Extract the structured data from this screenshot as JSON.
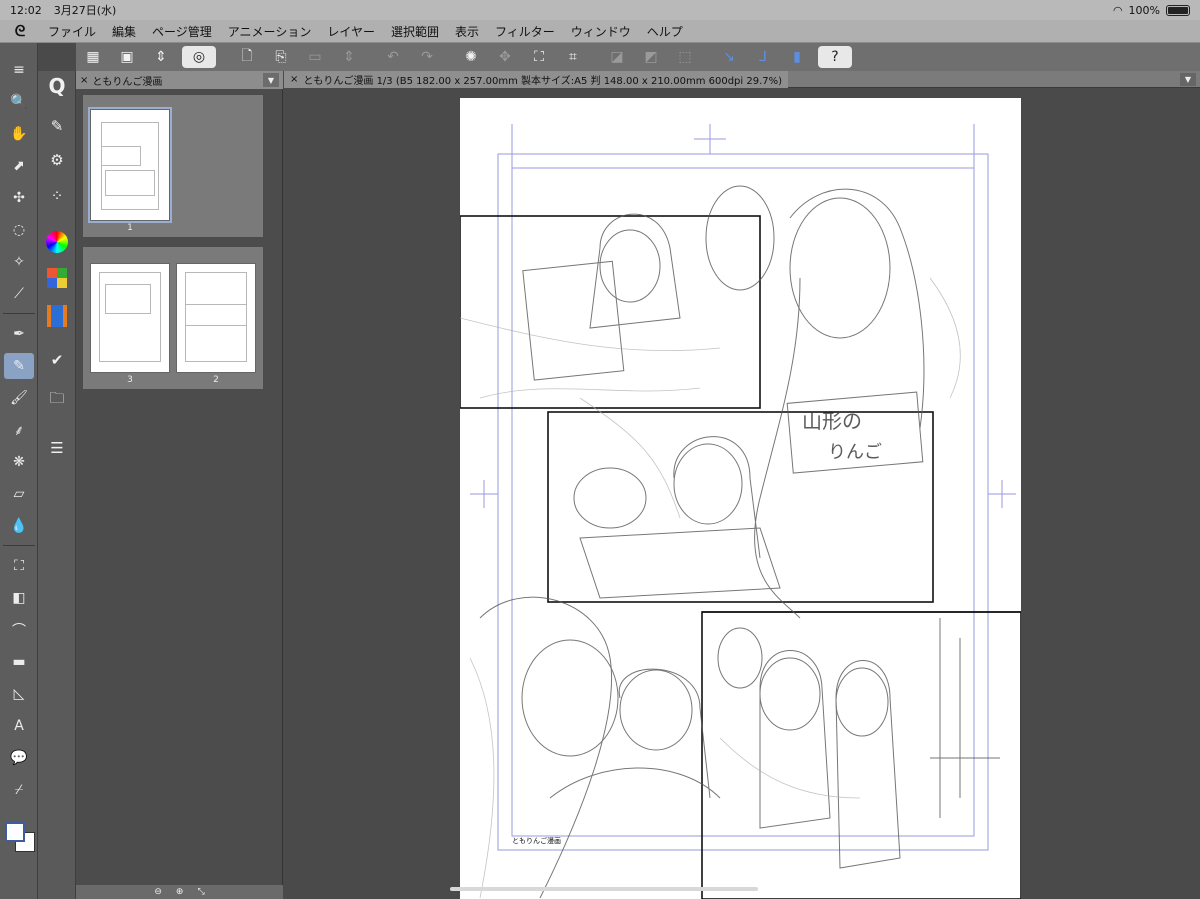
{
  "status_bar": {
    "time": "12:02",
    "date": "3月27日(水)",
    "battery": "100%"
  },
  "menu": {
    "logo_icon": "clip-studio-logo-icon",
    "items": [
      "ファイル",
      "編集",
      "ページ管理",
      "アニメーション",
      "レイヤー",
      "選択範囲",
      "表示",
      "フィルター",
      "ウィンドウ",
      "ヘルプ"
    ]
  },
  "page_panel": {
    "tab_title": "ともりんご漫画",
    "page_numbers": [
      "1",
      "3",
      "2"
    ]
  },
  "document": {
    "tab_title": "ともりんご漫画 1/3 (B5 182.00 x 257.00mm 製本サイズ:A5 判 148.00 x 210.00mm 600dpi 29.7%)",
    "footer_text": "ともりんご漫画"
  },
  "colors": {
    "accent": "#8aa3c4",
    "toolbar_bg": "#6f6f6f",
    "canvas_bg": "#4a4a4a"
  }
}
